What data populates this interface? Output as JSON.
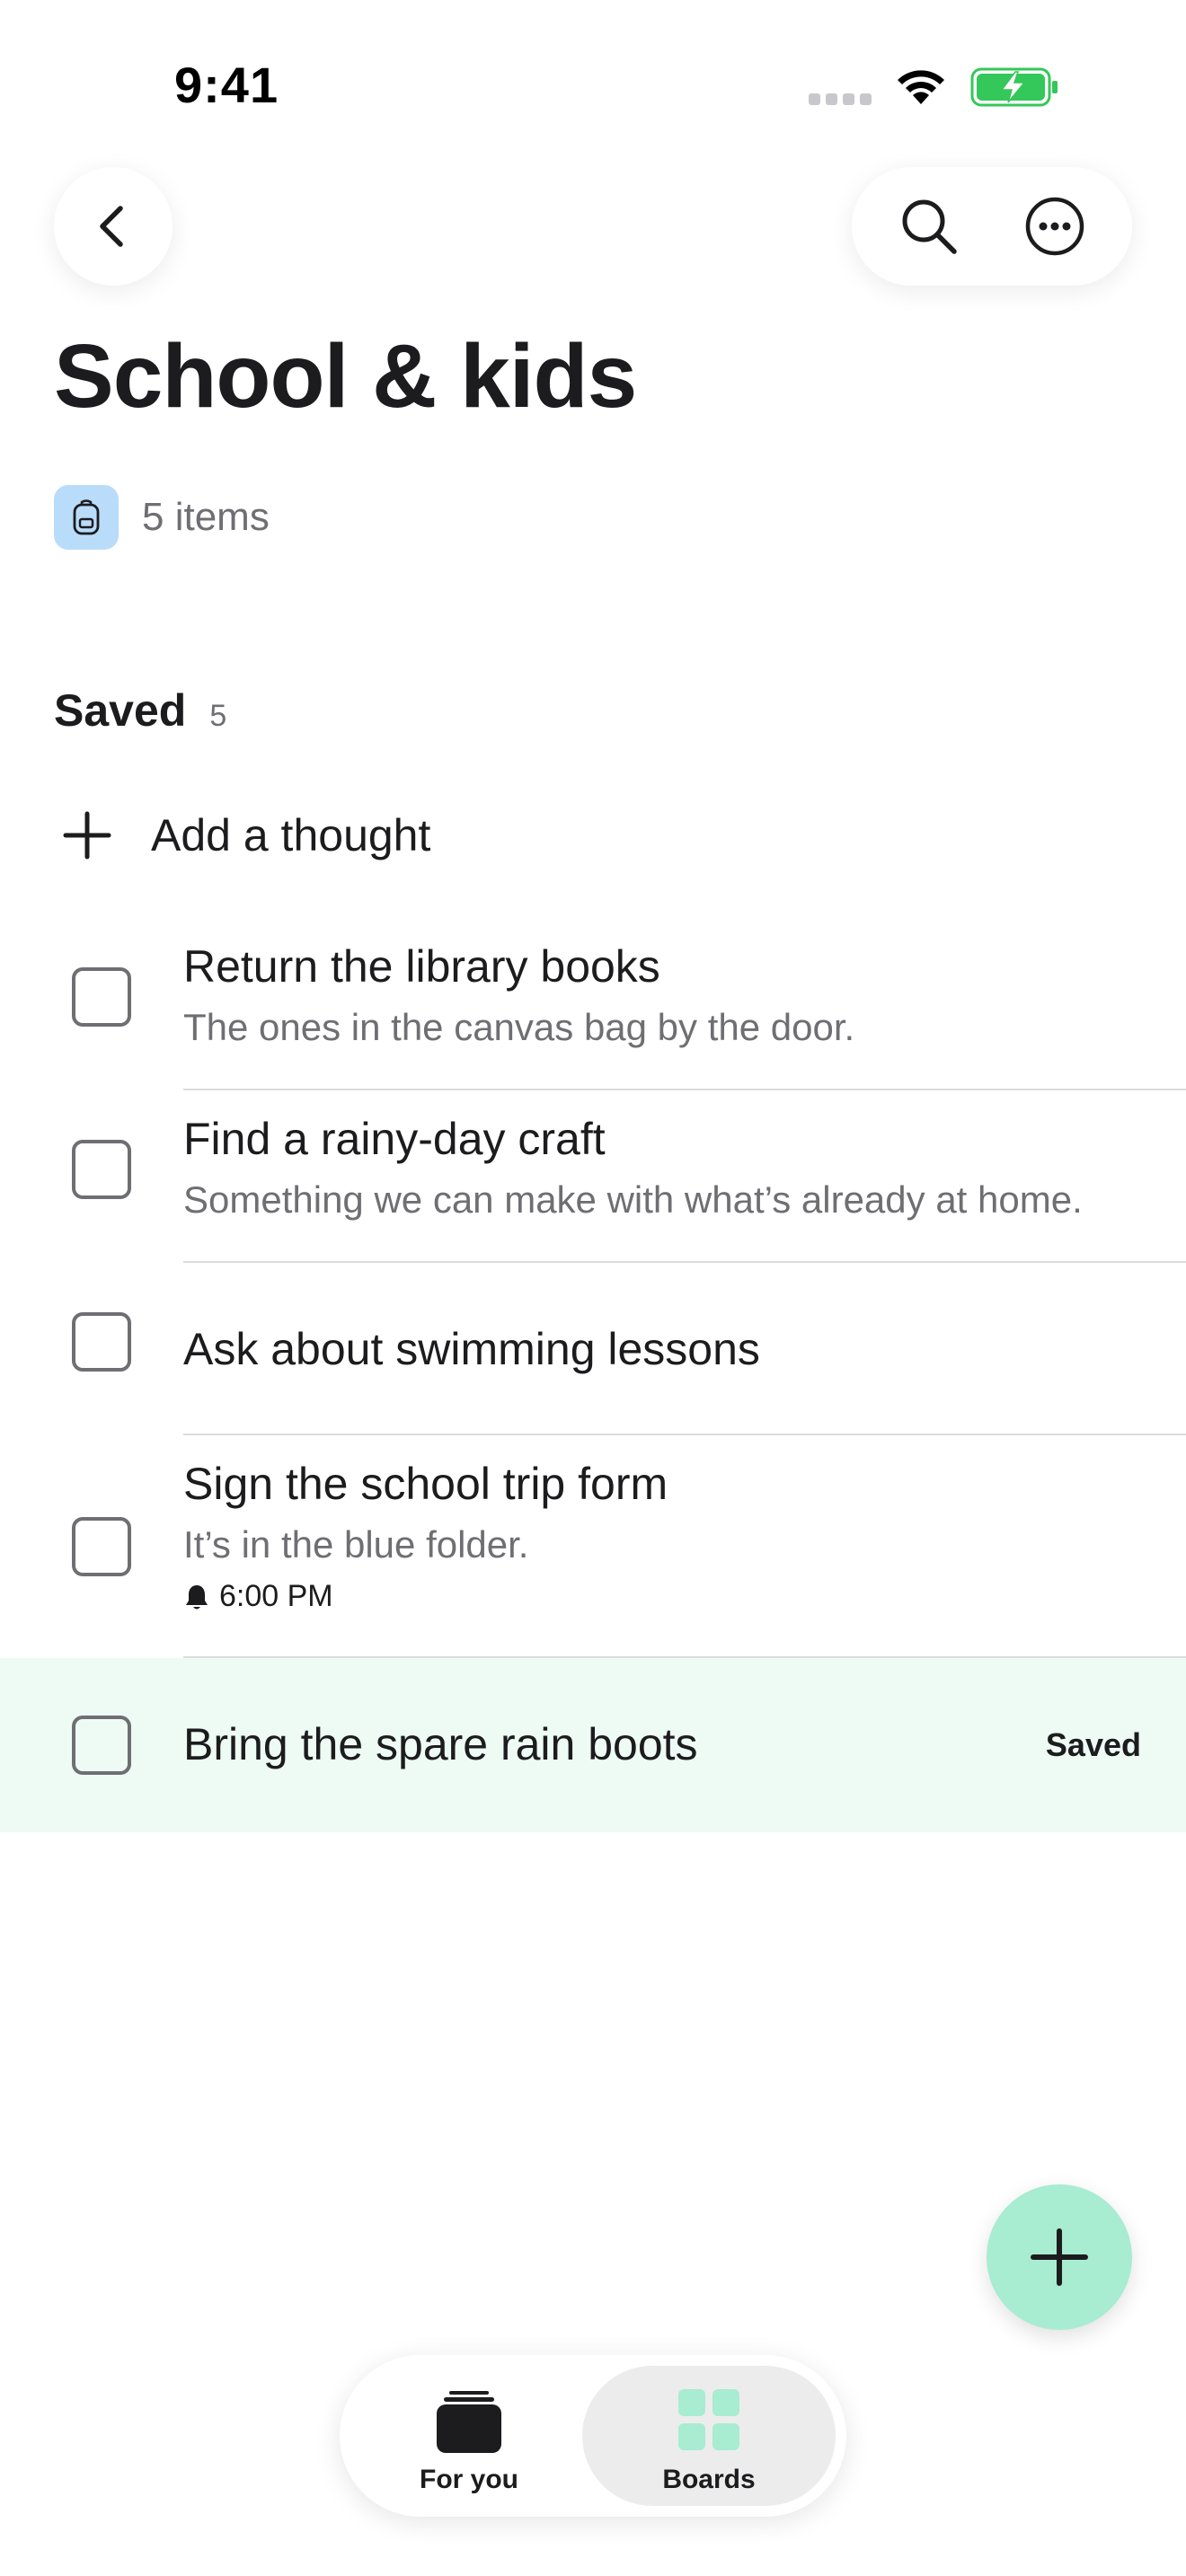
{
  "status_bar": {
    "time": "9:41"
  },
  "nav": {
    "back": "back",
    "search": "search",
    "more": "more"
  },
  "header": {
    "title": "School & kids",
    "item_count": "5 items",
    "board_icon": "backpack-icon"
  },
  "section": {
    "title": "Saved",
    "count": "5"
  },
  "add_thought": {
    "label": "Add a thought"
  },
  "items": [
    {
      "title": "Return the library books",
      "note": "The ones in the canvas bag by the door."
    },
    {
      "title": "Find a rainy-day craft",
      "note": "Something we can make with what’s already at home."
    },
    {
      "title": "Ask about swimming lessons"
    },
    {
      "title": "Sign the school trip form",
      "note": "It’s in the blue folder.",
      "reminder": "6:00 PM"
    },
    {
      "title": "Bring the spare rain boots",
      "status": "Saved"
    }
  ],
  "tabs": [
    {
      "label": "For you",
      "icon": "stack-icon"
    },
    {
      "label": "Boards",
      "icon": "grid-icon",
      "selected": true
    }
  ],
  "colors": {
    "accent": "#a8ecd2",
    "highlight_row": "#eefaf4",
    "board_icon_bg": "#b9dcfb",
    "battery_green": "#34c759"
  }
}
